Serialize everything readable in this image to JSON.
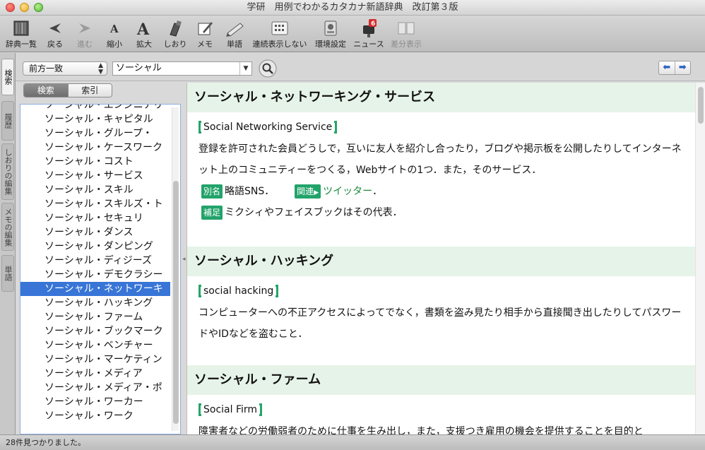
{
  "window": {
    "title": "学研　用例でわかるカタカナ新語辞典　改訂第３版"
  },
  "toolbar": {
    "items": [
      {
        "label": "辞典一覧",
        "icon": "books-icon",
        "enabled": true
      },
      {
        "label": "戻る",
        "icon": "back-arrow-icon",
        "enabled": true
      },
      {
        "label": "進む",
        "icon": "forward-arrow-icon",
        "enabled": false
      },
      {
        "label": "縮小",
        "icon": "font-smaller-icon",
        "enabled": true
      },
      {
        "label": "拡大",
        "icon": "font-larger-icon",
        "enabled": true
      },
      {
        "label": "しおり",
        "icon": "bookmark-icon",
        "enabled": true
      },
      {
        "label": "メモ",
        "icon": "memo-icon",
        "enabled": true
      },
      {
        "label": "単語",
        "icon": "word-icon",
        "enabled": true
      },
      {
        "label": "連続表示しない",
        "icon": "grid-icon",
        "enabled": true
      },
      {
        "label": "環境設定",
        "icon": "settings-icon",
        "enabled": true
      },
      {
        "label": "ニュース",
        "icon": "news-mailbox-icon",
        "enabled": true,
        "badge": "6"
      },
      {
        "label": "差分表示",
        "icon": "diff-icon",
        "enabled": false
      }
    ]
  },
  "side_tabs": [
    {
      "label": "検索",
      "active": true
    },
    {
      "label": "履歴",
      "active": false
    },
    {
      "label": "しおりの編集",
      "active": false
    },
    {
      "label": "メモの編集",
      "active": false
    },
    {
      "label": "単語",
      "active": false
    }
  ],
  "search": {
    "mode": "前方一致",
    "query": "ソーシャル",
    "tabs": {
      "search": "検索",
      "index": "索引"
    }
  },
  "word_list": {
    "items": [
      "ソーシャル・エンジニアリ",
      "ソーシャル・キャピタル",
      "ソーシャル・グループ・",
      "ソーシャル・ケースワーク",
      "ソーシャル・コスト",
      "ソーシャル・サービス",
      "ソーシャル・スキル",
      "ソーシャル・スキルズ・ト",
      "ソーシャル・セキュリ",
      "ソーシャル・ダンス",
      "ソーシャル・ダンピング",
      "ソーシャル・ディジーズ",
      "ソーシャル・デモクラシー",
      "ソーシャル・ネットワーキ",
      "ソーシャル・ハッキング",
      "ソーシャル・ファーム",
      "ソーシャル・ブックマーク",
      "ソーシャル・ベンチャー",
      "ソーシャル・マーケティン",
      "ソーシャル・メディア",
      "ソーシャル・メディア・ポ",
      "ソーシャル・ワーカー",
      "ソーシャル・ワーク"
    ],
    "selected_index": 13
  },
  "entries": [
    {
      "title": "ソーシャル・ネットワーキング・サービス",
      "english": "Social Networking Service",
      "body": "登録を許可された会員どうしで，互いに友人を紹介し合ったり，ブログや掲示板を公開したりしてインターネット上のコミュニティーをつくる，Webサイトの1つ．また，そのサービス．",
      "alias_tag": "別名",
      "alias": "略語SNS．",
      "related_tag": "関連",
      "related_link": "ツイッター",
      "related_suffix": "．",
      "supplement_tag": "補足",
      "supplement": "ミクシィやフェイスブックはその代表．"
    },
    {
      "title": "ソーシャル・ハッキング",
      "english": "social hacking",
      "body": "コンピューターへの不正アクセスによってでなく，書類を盗み見たり相手から直接聞き出したりしてパスワードやIDなどを盗むこと．"
    },
    {
      "title": "ソーシャル・ファーム",
      "english": "Social Firm",
      "body": "障害者などの労働弱者のために仕事を生み出し，また，支援つき雇用の機会を提供することを目的と"
    }
  ],
  "status": {
    "text": "28件見つかりました。"
  },
  "colors": {
    "accent_green": "#22a36a",
    "title_band": "#e6f3e8",
    "selection_blue": "#3875d7"
  }
}
